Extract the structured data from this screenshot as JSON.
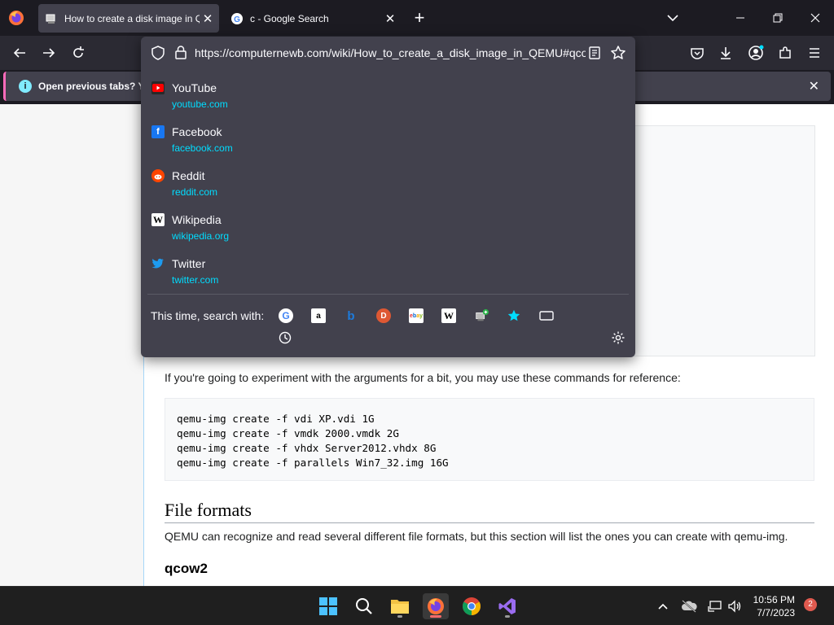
{
  "tabs": [
    {
      "title": "How to create a disk image in QEMU",
      "active": true
    },
    {
      "title": "c - Google Search",
      "active": false
    }
  ],
  "urlbar": {
    "url": "https://computernewb.com/wiki/How_to_create_a_disk_image_in_QEMU#qcow"
  },
  "notification": {
    "text": "Open previous tabs? You"
  },
  "suggestions": [
    {
      "name": "YouTube",
      "url": "youtube.com",
      "icon": "youtube-icon",
      "color": "#ff0000"
    },
    {
      "name": "Facebook",
      "url": "facebook.com",
      "icon": "facebook-icon",
      "color": "#1877f2"
    },
    {
      "name": "Reddit",
      "url": "reddit.com",
      "icon": "reddit-icon",
      "color": "#ff4500"
    },
    {
      "name": "Wikipedia",
      "url": "wikipedia.org",
      "icon": "wikipedia-icon",
      "color": "#ffffff"
    },
    {
      "name": "Twitter",
      "url": "twitter.com",
      "icon": "twitter-icon",
      "color": "#1d9bf0"
    }
  ],
  "search_with": {
    "label": "This time, search with:",
    "engines": [
      "google-icon",
      "amazon-icon",
      "bing-icon",
      "duckduckgo-icon",
      "ebay-icon",
      "wikipedia-icon",
      "computernewb-icon",
      "bookmarks-icon",
      "tabs-icon",
      "history-icon"
    ]
  },
  "page": {
    "intro": "If you're going to experiment with the arguments for a bit, you may use these commands for reference:",
    "code_lines": [
      "qemu-img create -f vdi XP.vdi 1G",
      "qemu-img create -f vmdk 2000.vmdk 2G",
      "qemu-img create -f vhdx Server2012.vhdx 8G",
      "qemu-img create -f parallels Win7_32.img 16G"
    ],
    "heading": "File formats",
    "formats_para": "QEMU can recognize and read several different file formats, but this section will list the ones you can create with qemu-img.",
    "subheading": "qcow2"
  },
  "taskbar": {
    "time": "10:56 PM",
    "date": "7/7/2023",
    "notifications": "2"
  },
  "colors": {
    "accent": "#00ddff",
    "chrome_bg": "#1c1b22",
    "panel_bg": "#42414d"
  }
}
